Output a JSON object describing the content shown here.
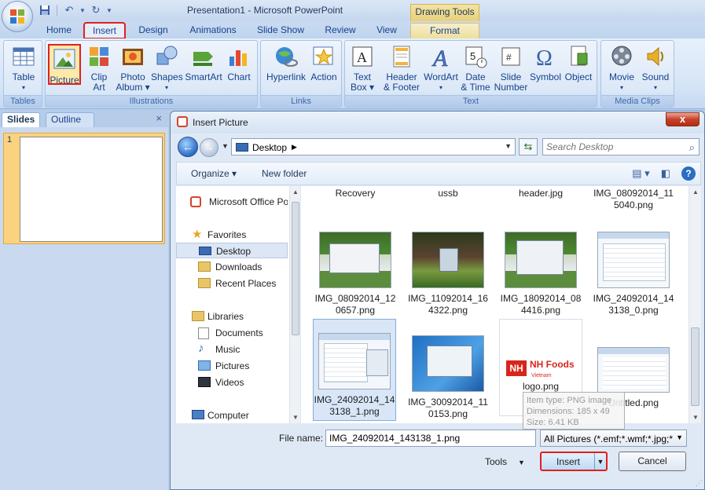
{
  "titlebar": {
    "title": "Presentation1 - Microsoft PowerPoint",
    "contextual": "Drawing Tools"
  },
  "tabs": [
    "Home",
    "Insert",
    "Design",
    "Animations",
    "Slide Show",
    "Review",
    "View",
    "Format"
  ],
  "ribbon": {
    "groups": {
      "tables": "Tables",
      "illustrations": "Illustrations",
      "links": "Links",
      "text": "Text",
      "media": "Media Clips"
    },
    "buttons": {
      "table": [
        "Table",
        ""
      ],
      "picture": [
        "Picture",
        ""
      ],
      "clipart": [
        "Clip",
        "Art"
      ],
      "photoalbum": [
        "Photo",
        "Album"
      ],
      "shapes": [
        "Shapes",
        ""
      ],
      "smartart": [
        "SmartArt",
        ""
      ],
      "chart": [
        "Chart",
        ""
      ],
      "hyperlink": [
        "Hyperlink",
        ""
      ],
      "action": [
        "Action",
        ""
      ],
      "textbox": [
        "Text",
        "Box"
      ],
      "headerfooter": [
        "Header",
        "& Footer"
      ],
      "wordart": [
        "WordArt",
        ""
      ],
      "datetime": [
        "Date",
        "& Time"
      ],
      "slidenumber": [
        "Slide",
        "Number"
      ],
      "symbol": [
        "Symbol",
        ""
      ],
      "object": [
        "Object",
        ""
      ],
      "movie": [
        "Movie",
        ""
      ],
      "sound": [
        "Sound",
        ""
      ]
    }
  },
  "slidepane": {
    "tab_slides": "Slides",
    "tab_outline": "Outline",
    "close": "×",
    "slide_number": "1"
  },
  "dialog": {
    "title": "Insert Picture",
    "close": "x",
    "address": "Desktop",
    "search_placeholder": "Search Desktop",
    "organize": "Organize",
    "new_folder": "New folder",
    "nav": {
      "office": "Microsoft Office Po",
      "favorites": "Favorites",
      "desktop": "Desktop",
      "downloads": "Downloads",
      "recent": "Recent Places",
      "libraries": "Libraries",
      "documents": "Documents",
      "music": "Music",
      "pictures": "Pictures",
      "videos": "Videos",
      "computer": "Computer"
    },
    "files_top": [
      "Recovery",
      "ussb",
      "header.jpg",
      "IMG_08092014_11 5040.png"
    ],
    "files_row2": [
      "IMG_08092014_12 0657.png",
      "IMG_11092014_16 4322.png",
      "IMG_18092014_08 4416.png",
      "IMG_24092014_14 3138_0.png"
    ],
    "files_row3": [
      "IMG_24092014_14 3138_1.png",
      "IMG_30092014_11 0153.png",
      "logo.png",
      "Untitled.png"
    ],
    "logo_text": "NH Foods",
    "logo_sub": "Vietnam",
    "tooltip": [
      "Item type: PNG image",
      "Dimensions: 185 x 49",
      "Size: 6.41 KB"
    ],
    "file_name_label": "File name:",
    "file_name_value": "IMG_24092014_143138_1.png",
    "file_type": "All Pictures (*.emf;*.wmf;*.jpg;*",
    "tools": "Tools",
    "insert": "Insert",
    "cancel": "Cancel"
  },
  "colors": {
    "highlight_red": "#e0201f",
    "ribbon_text": "#15428b",
    "selection_blue": "#d8e6f7"
  }
}
